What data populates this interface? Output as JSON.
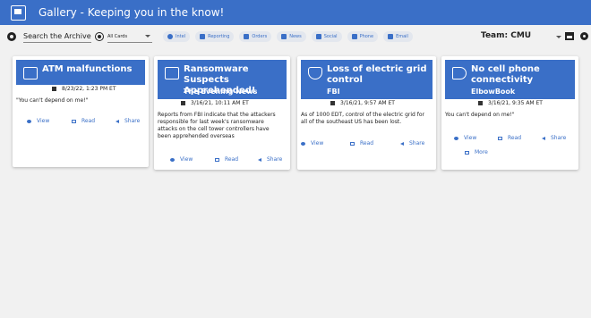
{
  "app": {
    "title": "Gallery - Keeping you in the know!"
  },
  "toolbar": {
    "search_value": "Search the Archive",
    "filter_selected": "All Cards",
    "chips": [
      "Intel",
      "Reporting",
      "Orders",
      "News",
      "Social",
      "Phone",
      "Email"
    ],
    "team_label": "Team:",
    "team_value": "CMU"
  },
  "cards": [
    {
      "title_lines": [
        "ATM malfunctions"
      ],
      "source": "",
      "date": "8/23/22, 1:23 PM ET",
      "body_lines": [
        "\"You can't depend on me!\""
      ],
      "actions": [
        "View",
        "Read",
        "Share"
      ]
    },
    {
      "title_lines": [
        "Ransomware Suspects",
        "Apprehended!"
      ],
      "source": "The Evening News",
      "date": "3/16/21, 10:11 AM ET",
      "body_lines": [
        "Reports from FBI indicate that the attackers",
        "responsible for last week's ransomware",
        "attacks on the cell tower controllers have",
        "been apprehended overseas"
      ],
      "actions": [
        "View",
        "Read",
        "Share"
      ]
    },
    {
      "title_lines": [
        "Loss of electric grid",
        "control"
      ],
      "source": "FBI",
      "date": "3/16/21, 9:57 AM ET",
      "body_lines": [
        "As of 1000 EDT, control of the electric grid for",
        "all of the southeast US has been lost."
      ],
      "actions": [
        "View",
        "Read",
        "Share"
      ]
    },
    {
      "title_lines": [
        "No cell phone",
        "connectivity"
      ],
      "source": "ElbowBook",
      "date": "3/16/21, 9:35 AM ET",
      "body_lines": [
        "You can't depend on me!\""
      ],
      "actions": [
        "View",
        "Read",
        "Share",
        "More"
      ]
    }
  ],
  "colors": {
    "primary": "#3a6fc7",
    "background": "#f1f1f1",
    "card": "#ffffff"
  },
  "icons": {
    "app": "gallery-icon",
    "cards": [
      "tv-icon",
      "tv-icon",
      "shield-lock-icon",
      "megaphone-icon"
    ],
    "actions": [
      "eye-icon",
      "open-in-new-icon",
      "share-icon",
      "reply-icon"
    ]
  }
}
